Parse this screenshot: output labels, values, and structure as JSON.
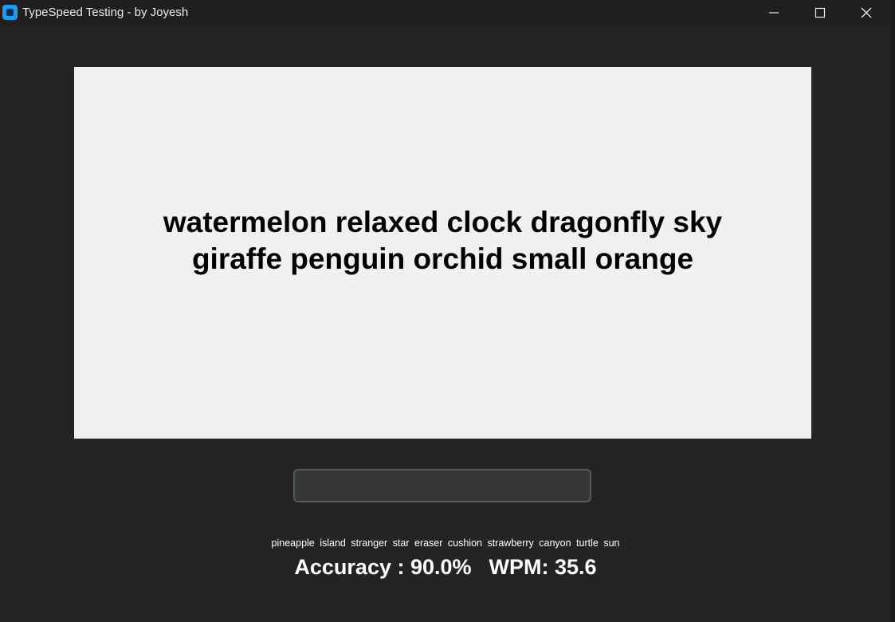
{
  "window": {
    "title": "TypeSpeed Testing - by Joyesh"
  },
  "prompt": {
    "text": "watermelon relaxed clock dragonfly sky giraffe penguin orchid small orange"
  },
  "input": {
    "value": "",
    "placeholder": ""
  },
  "upcoming_words": "pineapple island stranger star eraser cushion strawberry canyon turtle sun",
  "stats": {
    "accuracy": "Accuracy : 90.0%",
    "wpm": "WPM: 35.6"
  },
  "icons": {
    "app": "app-icon",
    "minimize": "minimize-icon",
    "maximize": "maximize-icon",
    "close": "close-icon"
  },
  "colors": {
    "background": "#242424",
    "panel": "#f0f0f0",
    "accent": "#1e9bf0"
  }
}
